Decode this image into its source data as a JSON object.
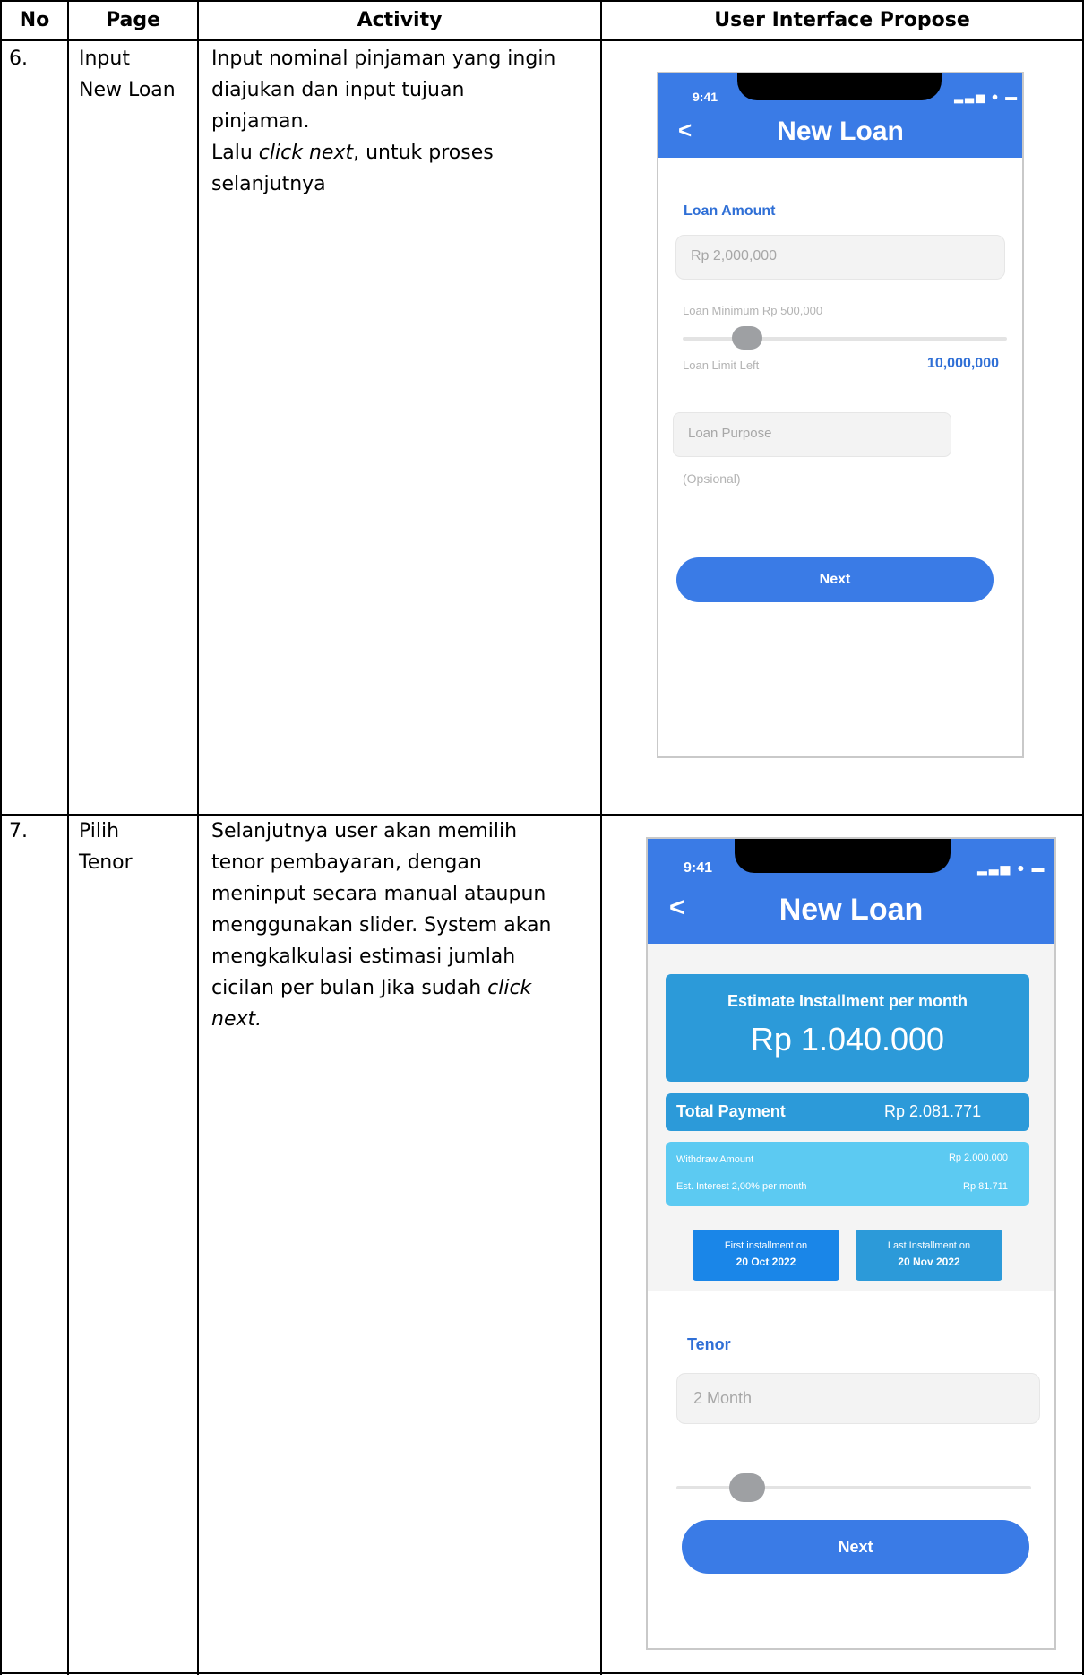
{
  "table": {
    "headers": {
      "no": "No",
      "page": "Page",
      "activity": "Activity",
      "ui": "User Interface Propose"
    },
    "rows": [
      {
        "no": "6.",
        "page_line1": "Input",
        "page_line2": "New Loan",
        "activity_lines": [
          "Input nominal pinjaman yang ingin",
          "diajukan dan input tujuan",
          "pinjaman."
        ],
        "activity_click_prefix": "Lalu ",
        "activity_click_em": "click next",
        "activity_click_suffix": ", untuk proses",
        "activity_last": "selanjutnya"
      },
      {
        "no": "7.",
        "page_line1": "Pilih",
        "page_line2": "Tenor",
        "activity_lines": [
          "Selanjutnya user akan memilih",
          "tenor pembayaran, dengan",
          "meninput secara manual ataupun",
          "menggunakan slider. System akan",
          "mengkalkulasi estimasi jumlah"
        ],
        "activity_line6_text": "cicilan per bulan Jika sudah ",
        "activity_line6_em": "click",
        "activity_line7_em": "next."
      }
    ]
  },
  "screen1": {
    "time": "9:41",
    "status_icons": "▂▃▅ ● ▬",
    "back": "<",
    "title": "New Loan",
    "loan_amount_label": "Loan Amount",
    "amount_placeholder": "Rp 2,000,000",
    "min_label": "Loan Minimum Rp 500,000",
    "limit_label": "Loan Limit Left",
    "limit_value": "10,000,000",
    "slider_level": 0.2,
    "purpose_placeholder": "Loan Purpose",
    "optional": "(Opsional)",
    "next": "Next"
  },
  "screen2": {
    "time": "9:41",
    "status_icons": "▂▃▅ ● ▬",
    "back": "<",
    "title": "New Loan",
    "estimate_label": "Estimate Installment per month",
    "estimate_value": "Rp 1.040.000",
    "total_label": "Total Payment",
    "total_value": "Rp 2.081.771",
    "withdraw_label": "Withdraw Amount",
    "withdraw_value": "Rp 2.000.000",
    "interest_label": "Est. Interest 2,00% per month",
    "interest_value": "Rp 81.711",
    "first_label": "First installment on",
    "first_date": "20 Oct 2022",
    "last_label": "Last Installment on",
    "last_date": "20 Nov 2022",
    "tenor_label": "Tenor",
    "tenor_placeholder": "2 Month",
    "slider_level": 0.2,
    "next": "Next"
  },
  "colors": {
    "accent": "#3a7be6",
    "estimate_bg": "#2c9ad9",
    "withdraw_bg": "#5ccaf2",
    "first_date_bg": "#1a86e8"
  }
}
